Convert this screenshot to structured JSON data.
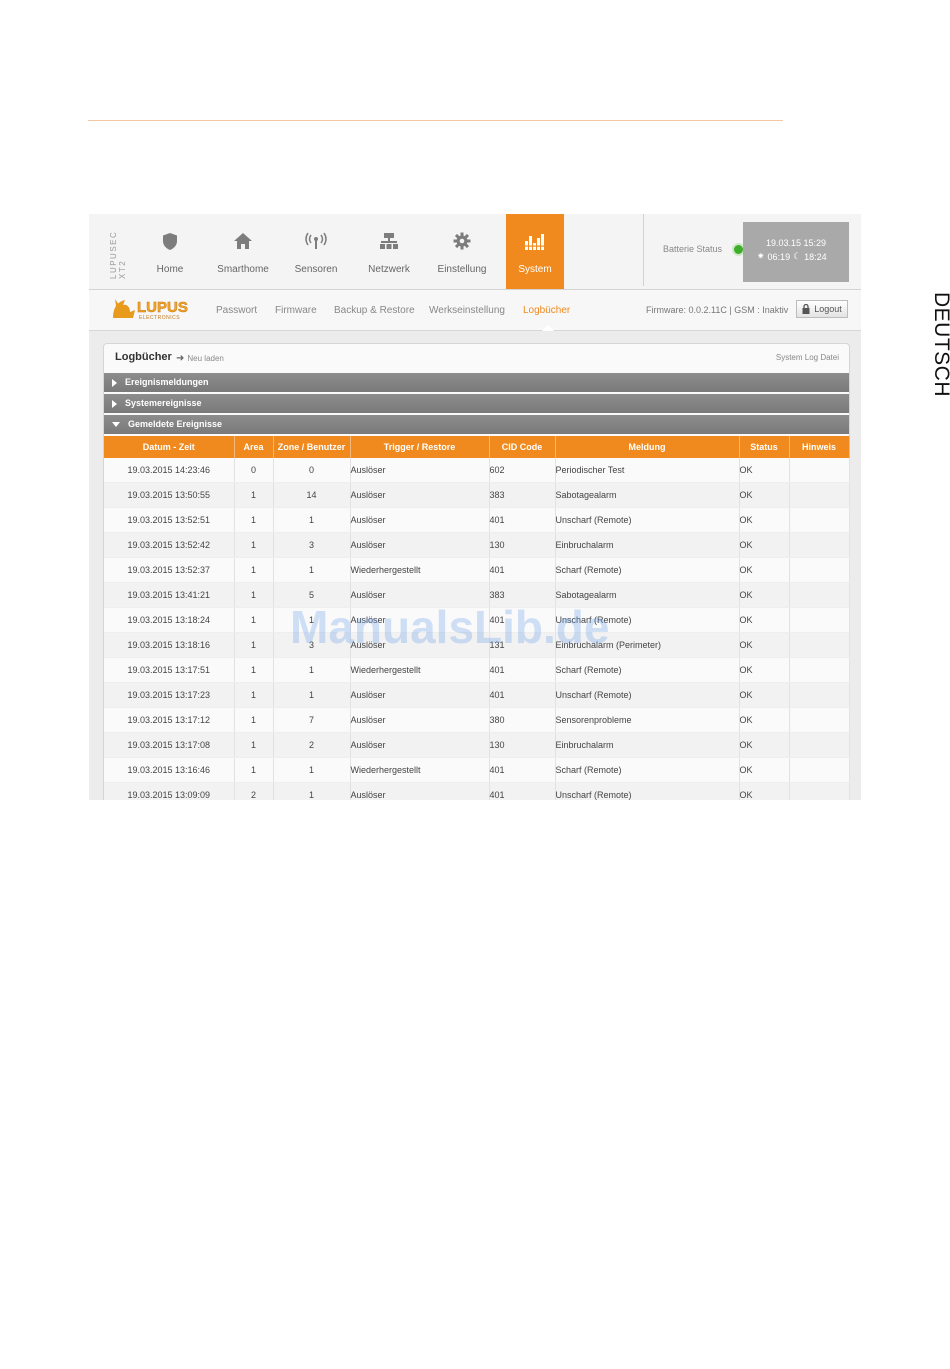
{
  "side_label": "DEUTSCH",
  "app": {
    "brand_line1": "LUPUSEC",
    "brand_line2": "XT2",
    "logo_text": "LUPUS",
    "logo_subtext": "ELECTRONICS"
  },
  "nav": [
    {
      "label": "Home",
      "icon": "shield-icon"
    },
    {
      "label": "Smarthome",
      "icon": "home-icon"
    },
    {
      "label": "Sensoren",
      "icon": "antenna-icon"
    },
    {
      "label": "Netzwerk",
      "icon": "network-icon"
    },
    {
      "label": "Einstellung",
      "icon": "gear-icon"
    },
    {
      "label": "System",
      "icon": "bars-icon",
      "active": true
    }
  ],
  "status": {
    "battery_label": "Batterie Status",
    "datetime": "19.03.15 15:29",
    "sunrise": "06:19",
    "sunset": "18:24"
  },
  "subnav": [
    {
      "label": "Passwort"
    },
    {
      "label": "Firmware"
    },
    {
      "label": "Backup & Restore"
    },
    {
      "label": "Werkseinstellung"
    },
    {
      "label": "Logbücher",
      "active": true
    }
  ],
  "firmware_info": "Firmware: 0.0.2.11C | GSM : Inaktiv",
  "logout_label": "Logout",
  "panel": {
    "title": "Logbücher",
    "reload_label": "Neu laden",
    "syslog_label": "System Log Datei"
  },
  "accordions": [
    {
      "label": "Ereignismeldungen",
      "expanded": false
    },
    {
      "label": "Systemereignisse",
      "expanded": false
    },
    {
      "label": "Gemeldete Ereignisse",
      "expanded": true
    }
  ],
  "table": {
    "headers": [
      "Datum - Zeit",
      "Area",
      "Zone / Benutzer",
      "Trigger / Restore",
      "CID Code",
      "Meldung",
      "Status",
      "Hinweis"
    ],
    "rows": [
      [
        "19.03.2015 14:23:46",
        "0",
        "0",
        "Auslöser",
        "602",
        "Periodischer Test",
        "OK",
        ""
      ],
      [
        "19.03.2015 13:50:55",
        "1",
        "14",
        "Auslöser",
        "383",
        "Sabotagealarm",
        "OK",
        ""
      ],
      [
        "19.03.2015 13:52:51",
        "1",
        "1",
        "Auslöser",
        "401",
        "Unscharf (Remote)",
        "OK",
        ""
      ],
      [
        "19.03.2015 13:52:42",
        "1",
        "3",
        "Auslöser",
        "130",
        "Einbruchalarm",
        "OK",
        ""
      ],
      [
        "19.03.2015 13:52:37",
        "1",
        "1",
        "Wiederhergestellt",
        "401",
        "Scharf (Remote)",
        "OK",
        ""
      ],
      [
        "19.03.2015 13:41:21",
        "1",
        "5",
        "Auslöser",
        "383",
        "Sabotagealarm",
        "OK",
        ""
      ],
      [
        "19.03.2015 13:18:24",
        "1",
        "1",
        "Auslöser",
        "401",
        "Unscharf (Remote)",
        "OK",
        ""
      ],
      [
        "19.03.2015 13:18:16",
        "1",
        "3",
        "Auslöser",
        "131",
        "Einbruchalarm (Perimeter)",
        "OK",
        ""
      ],
      [
        "19.03.2015 13:17:51",
        "1",
        "1",
        "Wiederhergestellt",
        "401",
        "Scharf (Remote)",
        "OK",
        ""
      ],
      [
        "19.03.2015 13:17:23",
        "1",
        "1",
        "Auslöser",
        "401",
        "Unscharf (Remote)",
        "OK",
        ""
      ],
      [
        "19.03.2015 13:17:12",
        "1",
        "7",
        "Auslöser",
        "380",
        "Sensorenprobleme",
        "OK",
        ""
      ],
      [
        "19.03.2015 13:17:08",
        "1",
        "2",
        "Auslöser",
        "130",
        "Einbruchalarm",
        "OK",
        ""
      ],
      [
        "19.03.2015 13:16:46",
        "1",
        "1",
        "Wiederhergestellt",
        "401",
        "Scharf (Remote)",
        "OK",
        ""
      ],
      [
        "19.03.2015 13:09:09",
        "2",
        "1",
        "Auslöser",
        "401",
        "Unscharf (Remote)",
        "OK",
        ""
      ]
    ]
  },
  "watermark": "ManualsLib.de",
  "colors": {
    "accent": "#f08a1e",
    "accordion": "#848484",
    "battery_ok": "#3fae2a"
  }
}
